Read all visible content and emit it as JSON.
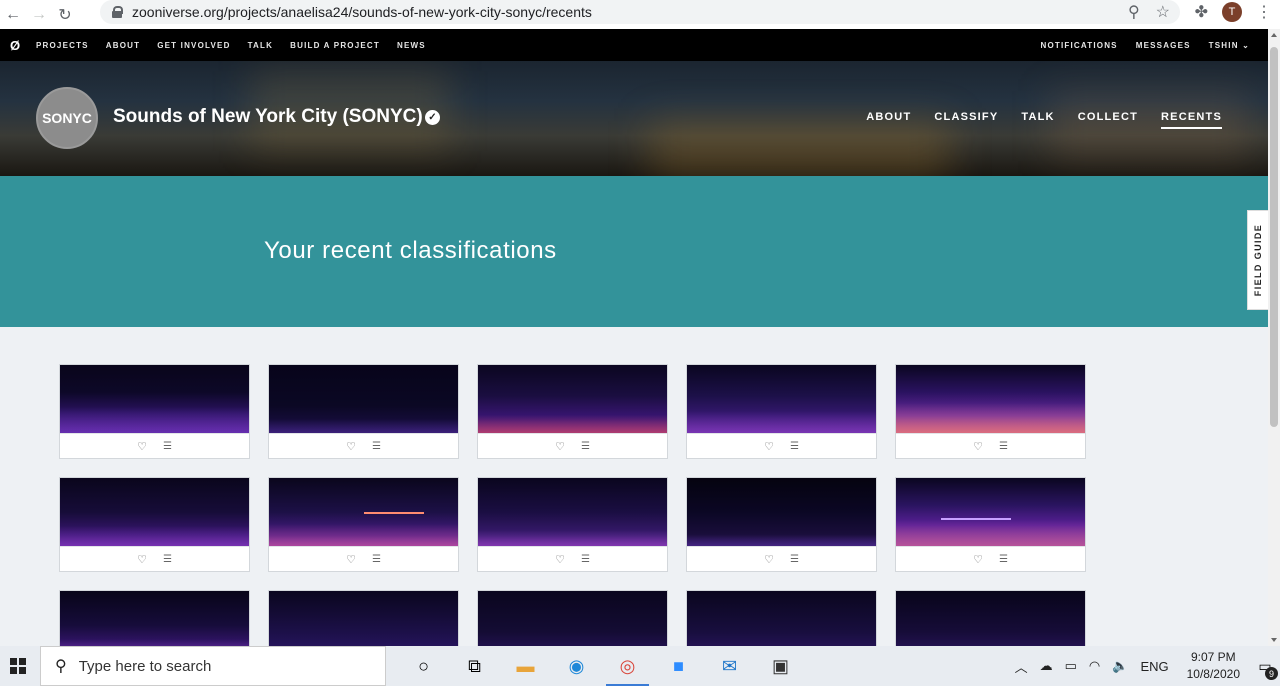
{
  "browser": {
    "url": "zooniverse.org/projects/anaelisa24/sounds-of-new-york-city-sonyc/recents",
    "avatar_letter": "T"
  },
  "zooniverse_nav": {
    "logo": "Ø",
    "items": [
      "PROJECTS",
      "ABOUT",
      "GET INVOLVED",
      "TALK",
      "BUILD A PROJECT",
      "NEWS"
    ],
    "right_items": [
      "NOTIFICATIONS",
      "MESSAGES",
      "TSHIN ⌄"
    ]
  },
  "project": {
    "logo_text": "SONYC",
    "title": "Sounds of New York City (SONYC)",
    "verified_icon": "check-badge-icon",
    "nav": [
      "ABOUT",
      "CLASSIFY",
      "TALK",
      "COLLECT",
      "RECENTS"
    ],
    "active_nav": "RECENTS"
  },
  "banner": {
    "heading": "Your recent classifications"
  },
  "field_guide": {
    "label": "FIELD GUIDE"
  },
  "recents": {
    "cards": [
      {
        "variant": "a"
      },
      {
        "variant": "b"
      },
      {
        "variant": "c"
      },
      {
        "variant": "d"
      },
      {
        "variant": "e"
      },
      {
        "variant": "f"
      },
      {
        "variant": "g"
      },
      {
        "variant": "h"
      },
      {
        "variant": "i"
      },
      {
        "variant": "j"
      },
      {
        "variant": "k"
      },
      {
        "variant": "l"
      },
      {
        "variant": "m"
      },
      {
        "variant": "n"
      },
      {
        "variant": "o"
      }
    ],
    "favorite_icon": "heart-icon",
    "collect_icon": "list-icon"
  },
  "taskbar": {
    "search_placeholder": "Type here to search",
    "apps": [
      "cortana-icon",
      "task-view-icon",
      "file-explorer-icon",
      "edge-icon",
      "chrome-icon",
      "zoom-icon",
      "mail-icon",
      "store-icon"
    ],
    "language": "ENG",
    "time": "9:07 PM",
    "date": "10/8/2020",
    "notification_count": "9"
  }
}
